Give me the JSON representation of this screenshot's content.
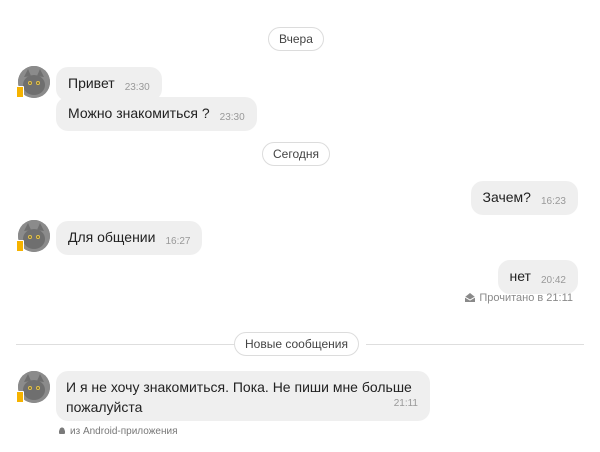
{
  "dates": {
    "yesterday": "Вчера",
    "today": "Сегодня"
  },
  "new_messages_label": "Новые сообщения",
  "messages": {
    "m1": {
      "text": "Привет",
      "time": "23:30"
    },
    "m2": {
      "text": "Можно знакомиться ?",
      "time": "23:30"
    },
    "m3": {
      "text": "Зачем?",
      "time": "16:23"
    },
    "m4": {
      "text": "Для общении",
      "time": "16:27"
    },
    "m5": {
      "text": "нет",
      "time": "20:42"
    },
    "m6": {
      "text": "И я не хочу знакомиться. Пока. Не пиши мне больше пожалуйста",
      "time": "21:11"
    }
  },
  "read_status": "Прочитано в 21:11",
  "source_note": "из Android-приложения",
  "icons": {
    "avatar": "cat-avatar",
    "mobile": "mobile-badge-icon",
    "read": "envelope-open-icon",
    "android": "android-icon"
  },
  "colors": {
    "bubble": "#efefef",
    "mobile_badge": "#f6b300"
  }
}
